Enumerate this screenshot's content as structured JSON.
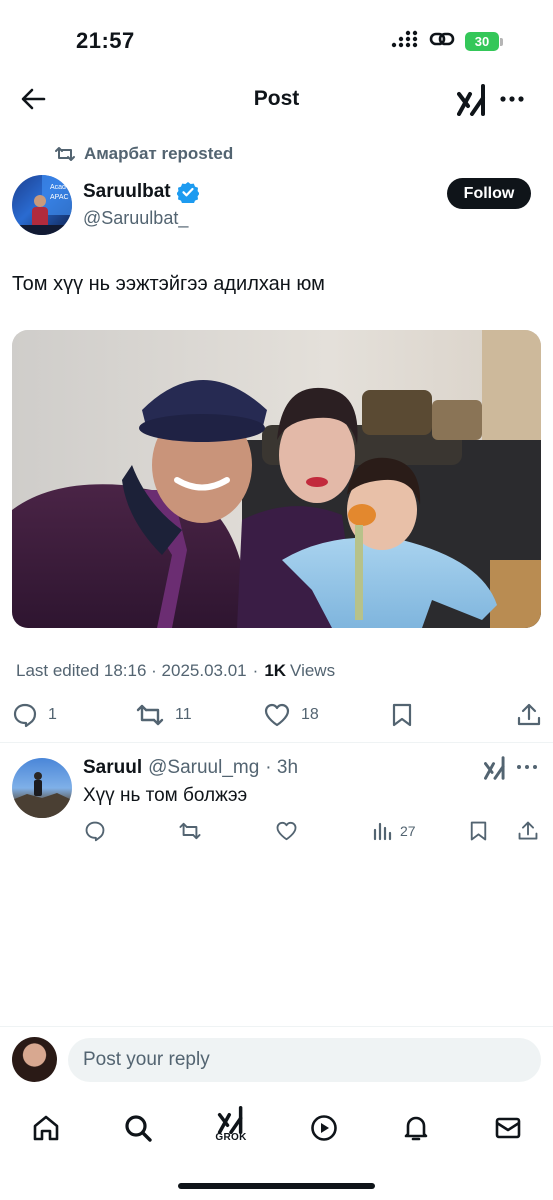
{
  "status_bar": {
    "time": "21:57",
    "battery": "30",
    "icons": [
      "cellular-signal-icon",
      "link-icon",
      "battery-icon"
    ]
  },
  "header": {
    "title": "Post",
    "icons": [
      "back-arrow-icon",
      "grok-icon",
      "more-icon"
    ]
  },
  "post": {
    "repost_label": "Амарбат reposted",
    "author_name": "Saruulbat",
    "author_handle": "@Saruulbat_",
    "verified": true,
    "follow_label": "Follow",
    "text": "Том хүү нь ээжтэйгээ адилхан юм",
    "media_kind": "photo",
    "edited_label": "Last edited 18:16 · 2025.03.01",
    "views_separator": "·",
    "views_count": "1K",
    "views_label": "Views",
    "stats": {
      "replies": "1",
      "reposts": "11",
      "likes": "18"
    }
  },
  "reply": {
    "name": "Saruul",
    "handle": "@Saruul_mg",
    "time": "· 3h",
    "text": "Хүү нь том болжээ",
    "views": "27"
  },
  "composer": {
    "placeholder": "Post your reply"
  },
  "tabbar": {
    "grok_label": "GROK",
    "tabs": [
      "home-icon",
      "search-icon",
      "grok-icon",
      "play-icon",
      "bell-icon",
      "mail-icon"
    ]
  },
  "colors": {
    "text": "#0f1419",
    "secondary": "#536471",
    "verified": "#1d9bf0",
    "battery": "#34c759",
    "divider": "#eff3f4"
  }
}
